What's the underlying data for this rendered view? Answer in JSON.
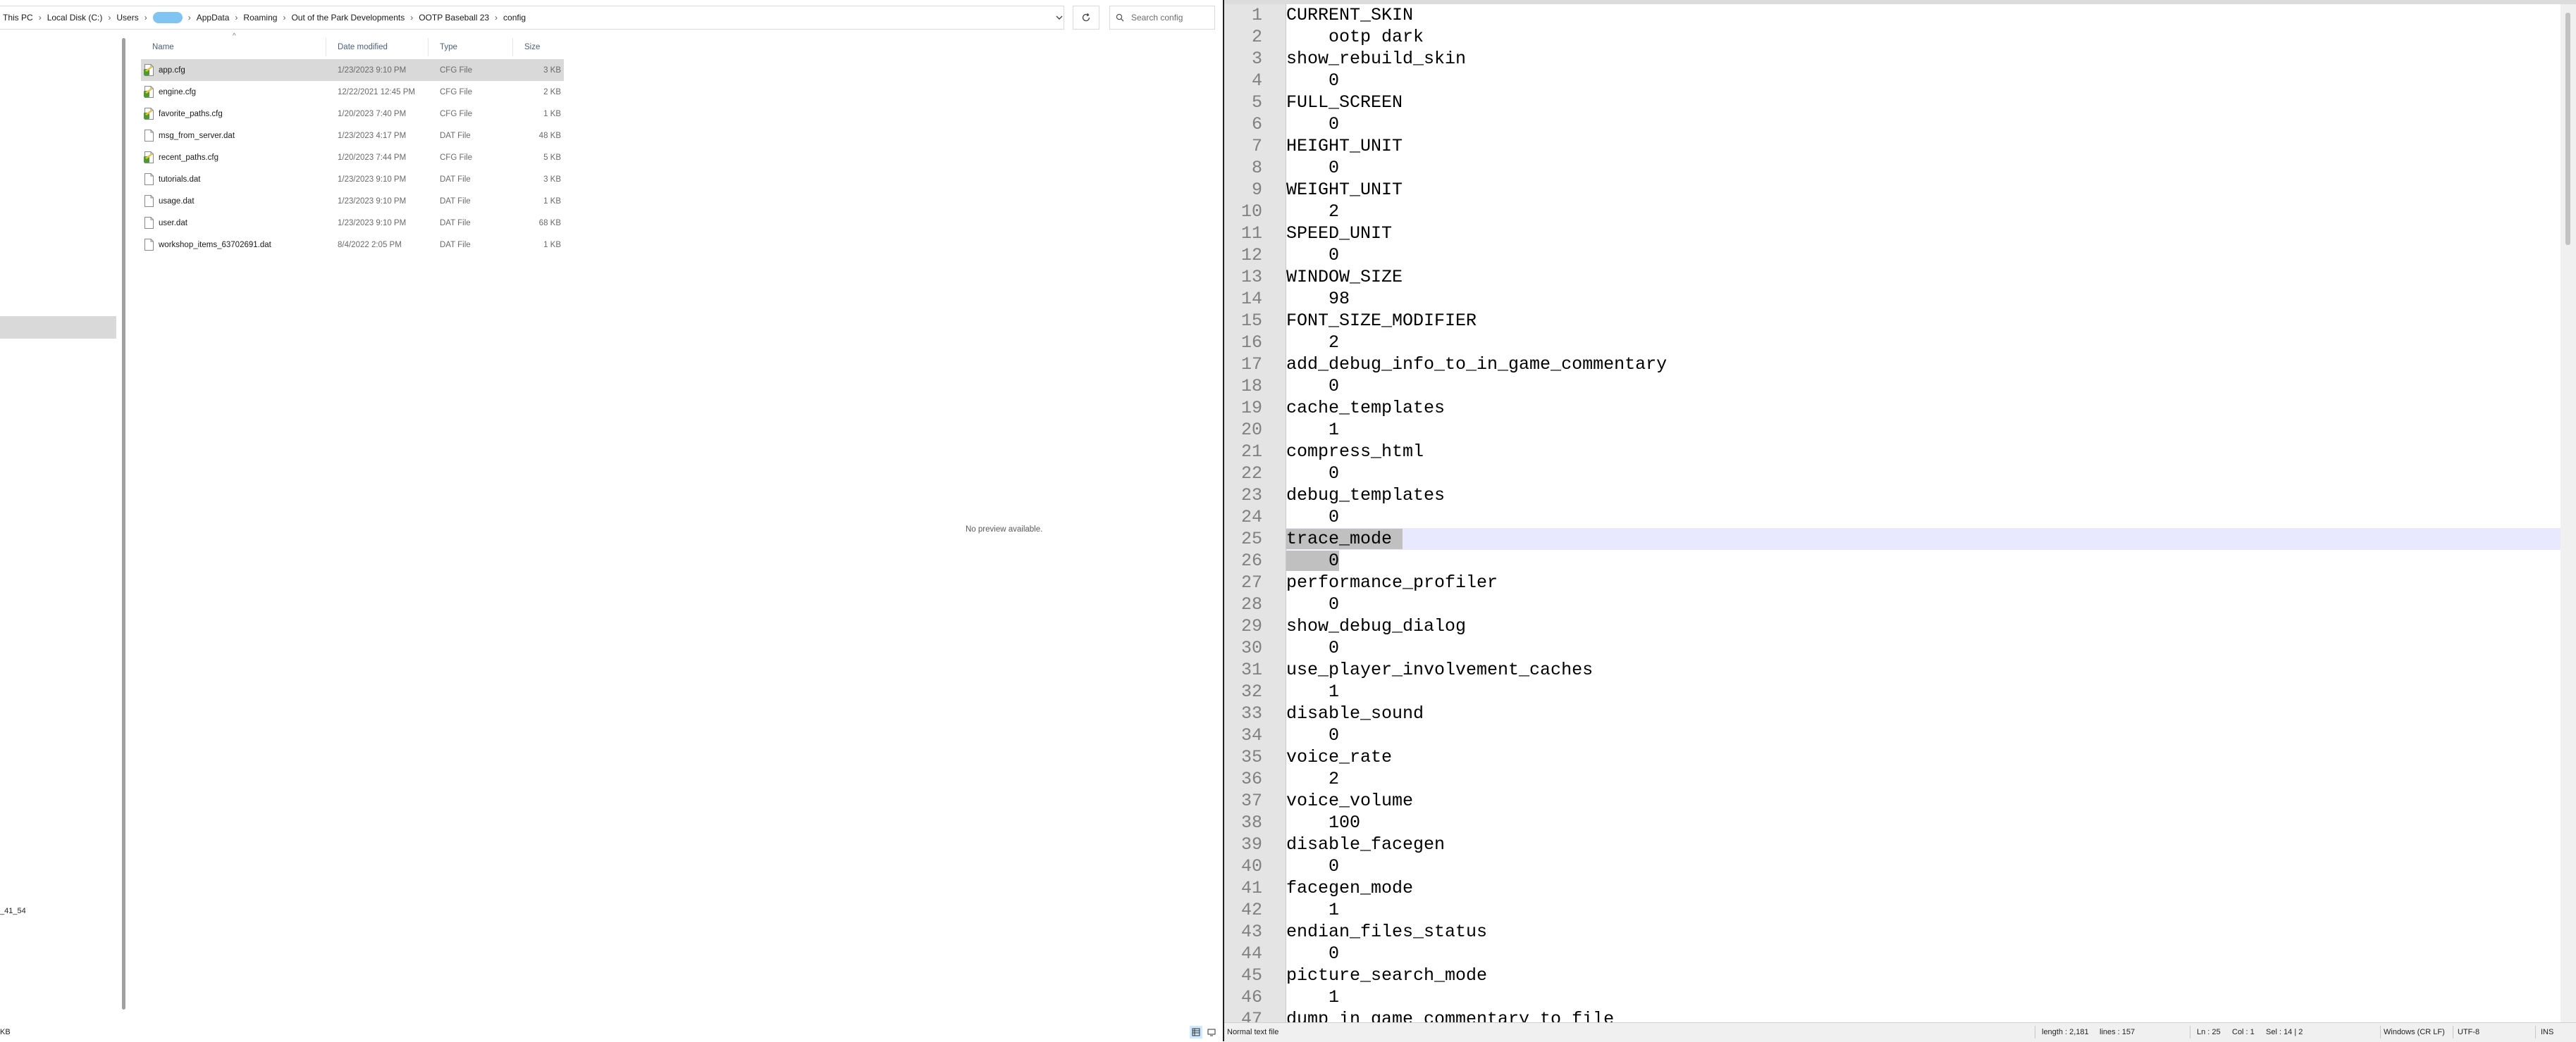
{
  "explorer": {
    "breadcrumbs": [
      {
        "label": "This PC"
      },
      {
        "label": "Local Disk (C:)"
      },
      {
        "label": "Users"
      },
      {
        "label": "",
        "redacted": true
      },
      {
        "label": "AppData"
      },
      {
        "label": "Roaming"
      },
      {
        "label": "Out of the Park Developments"
      },
      {
        "label": "OOTP Baseball 23"
      },
      {
        "label": "config"
      }
    ],
    "search_placeholder": "Search config",
    "columns": {
      "name": "Name",
      "date": "Date modified",
      "type": "Type",
      "size": "Size"
    },
    "files": [
      {
        "name": "app.cfg",
        "date": "1/23/2023 9:10 PM",
        "type": "CFG File",
        "size": "3 KB",
        "icon": "cfg-file-icon",
        "selected": true
      },
      {
        "name": "engine.cfg",
        "date": "12/22/2021 12:45 PM",
        "type": "CFG File",
        "size": "2 KB",
        "icon": "cfg-file-icon"
      },
      {
        "name": "favorite_paths.cfg",
        "date": "1/20/2023 7:40 PM",
        "type": "CFG File",
        "size": "1 KB",
        "icon": "cfg-file-icon"
      },
      {
        "name": "msg_from_server.dat",
        "date": "1/23/2023 4:17 PM",
        "type": "DAT File",
        "size": "48 KB",
        "icon": "file-icon"
      },
      {
        "name": "recent_paths.cfg",
        "date": "1/20/2023 7:44 PM",
        "type": "CFG File",
        "size": "5 KB",
        "icon": "cfg-file-icon"
      },
      {
        "name": "tutorials.dat",
        "date": "1/23/2023 9:10 PM",
        "type": "DAT File",
        "size": "3 KB",
        "icon": "file-icon"
      },
      {
        "name": "usage.dat",
        "date": "1/23/2023 9:10 PM",
        "type": "DAT File",
        "size": "1 KB",
        "icon": "file-icon"
      },
      {
        "name": "user.dat",
        "date": "1/23/2023 9:10 PM",
        "type": "DAT File",
        "size": "68 KB",
        "icon": "file-icon"
      },
      {
        "name": "workshop_items_63702691.dat",
        "date": "8/4/2022 2:05 PM",
        "type": "DAT File",
        "size": "1 KB",
        "icon": "file-icon"
      }
    ],
    "preview_text": "No preview available.",
    "nav_snippet": "_41_54",
    "status_left": "KB"
  },
  "notepad": {
    "lines": [
      "CURRENT_SKIN",
      "    ootp dark",
      "show_rebuild_skin",
      "    0",
      "FULL_SCREEN",
      "    0",
      "HEIGHT_UNIT",
      "    0",
      "WEIGHT_UNIT",
      "    2",
      "SPEED_UNIT",
      "    0",
      "WINDOW_SIZE",
      "    98",
      "FONT_SIZE_MODIFIER",
      "    2",
      "add_debug_info_to_in_game_commentary",
      "    0",
      "cache_templates",
      "    1",
      "compress_html",
      "    0",
      "debug_templates",
      "    0",
      "trace_mode",
      "    0",
      "performance_profiler",
      "    0",
      "show_debug_dialog",
      "    0",
      "use_player_involvement_caches",
      "    1",
      "disable_sound",
      "    0",
      "voice_rate",
      "    2",
      "voice_volume",
      "    100",
      "disable_facegen",
      "    0",
      "facegen_mode",
      "    1",
      "endian_files_status",
      "    0",
      "picture_search_mode",
      "    1",
      "dump_in_game_commentary_to_file"
    ],
    "current_line": 25,
    "selected_lines": [
      25,
      26
    ],
    "status": {
      "file_type": "Normal text file",
      "length": "length : 2,181",
      "lines": "lines : 157",
      "ln": "Ln : 25",
      "col": "Col : 1",
      "sel": "Sel : 14 | 2",
      "eol": "Windows (CR LF)",
      "encoding": "UTF-8",
      "mode": "INS"
    }
  }
}
